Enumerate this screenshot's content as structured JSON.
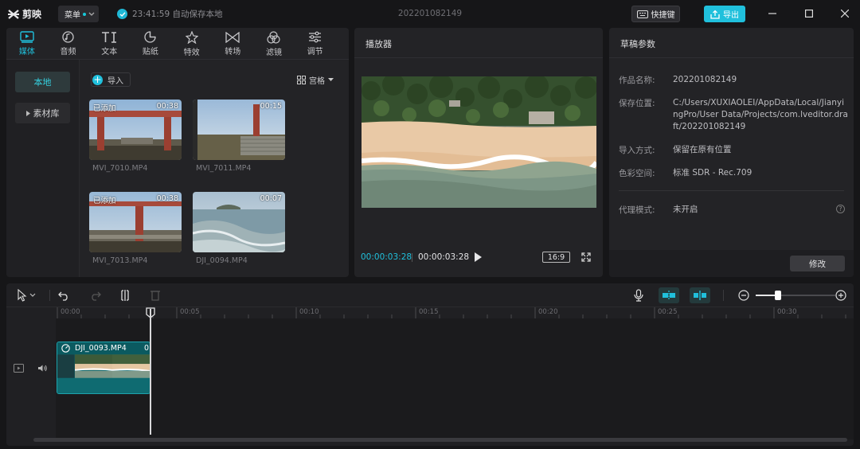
{
  "app": {
    "logo_text": "剪映",
    "menu_label": "菜单",
    "save_status": "23:41:59 自动保存本地",
    "doc_title": "202201082149",
    "shortcut_label": "快捷键",
    "export_label": "导出"
  },
  "media": {
    "tabs": [
      {
        "label": "媒体",
        "icon": "media-icon",
        "active": true
      },
      {
        "label": "音频",
        "icon": "audio-icon",
        "active": false
      },
      {
        "label": "文本",
        "icon": "text-icon",
        "active": false
      },
      {
        "label": "贴纸",
        "icon": "sticker-icon",
        "active": false
      },
      {
        "label": "特效",
        "icon": "effects-icon",
        "active": false
      },
      {
        "label": "转场",
        "icon": "transition-icon",
        "active": false
      },
      {
        "label": "滤镜",
        "icon": "filter-icon",
        "active": false
      },
      {
        "label": "调节",
        "icon": "adjust-icon",
        "active": false
      }
    ],
    "side": {
      "local": "本地",
      "library": "素材库"
    },
    "import_label": "导入",
    "view_label": "宫格",
    "items": [
      {
        "name": "MVI_7010.MP4",
        "duration": "00:38",
        "added": "已添加"
      },
      {
        "name": "MVI_7011.MP4",
        "duration": "00:15",
        "added": ""
      },
      {
        "name": "MVI_7013.MP4",
        "duration": "00:38",
        "added": "已添加"
      },
      {
        "name": "DJI_0094.MP4",
        "duration": "00:07",
        "added": ""
      }
    ]
  },
  "player": {
    "title": "播放器",
    "current_time": "00:00:03:28",
    "total_time": "00:00:03:28",
    "ratio": "16:9"
  },
  "params": {
    "title": "草稿参数",
    "rows": [
      {
        "key": "作品名称:",
        "value": "202201082149"
      },
      {
        "key": "保存位置:",
        "value": "C:/Users/XUXIAOLEI/AppData/Local/JianyingPro/User Data/Projects/com.lveditor.draft/202201082149"
      },
      {
        "key": "导入方式:",
        "value": "保留在原有位置"
      },
      {
        "key": "色彩空间:",
        "value": "标准 SDR - Rec.709"
      }
    ],
    "proxy_key": "代理模式:",
    "proxy_value": "未开启",
    "modify_label": "修改"
  },
  "timeline": {
    "ticks": [
      "00:00",
      "00:05",
      "00:10",
      "00:15",
      "00:20",
      "00:25",
      "00:30"
    ],
    "clip_name": "DJI_0093.MP4",
    "clip_trailing": "0"
  },
  "colors": {
    "accent": "#20c0dc",
    "panel_bg": "#232326",
    "app_bg": "#161618"
  }
}
